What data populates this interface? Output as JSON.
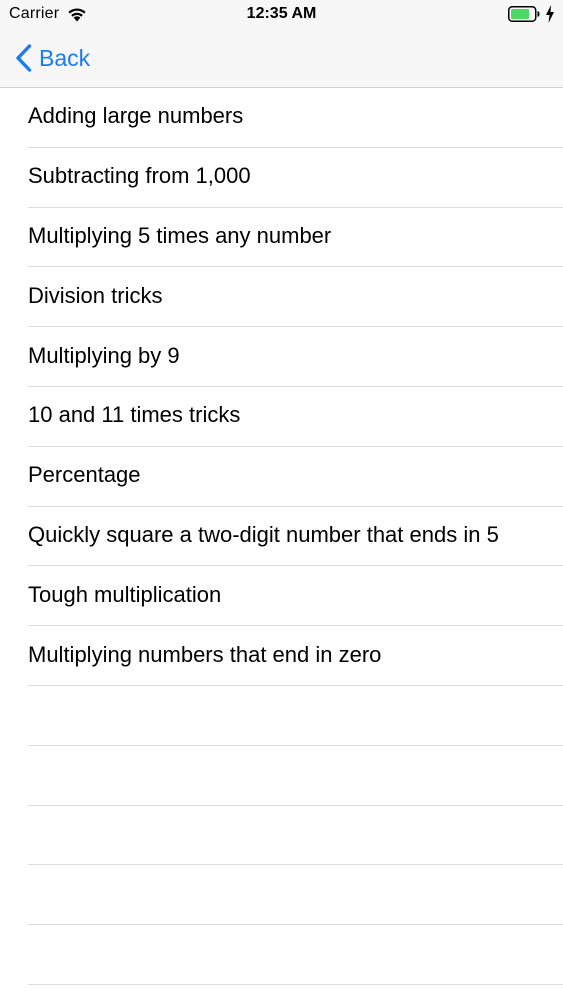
{
  "status_bar": {
    "carrier": "Carrier",
    "time": "12:35 AM",
    "wifi_icon": "wifi-icon",
    "battery_icon": "battery-icon",
    "charging_icon": "charging-bolt-icon",
    "battery_color": "#4cd964"
  },
  "nav": {
    "back_label": "Back",
    "back_icon": "chevron-left-icon",
    "tint_color": "#1a7cf5"
  },
  "list": {
    "items": [
      {
        "label": "Adding large numbers"
      },
      {
        "label": "Subtracting from 1,000"
      },
      {
        "label": "Multiplying 5 times any number"
      },
      {
        "label": "Division tricks"
      },
      {
        "label": "Multiplying by 9"
      },
      {
        "label": "10 and 11 times tricks"
      },
      {
        "label": "Percentage"
      },
      {
        "label": "Quickly square a two-digit number that ends in 5"
      },
      {
        "label": "Tough multiplication"
      },
      {
        "label": "Multiplying numbers that end in zero"
      }
    ],
    "empty_rows": 5
  }
}
